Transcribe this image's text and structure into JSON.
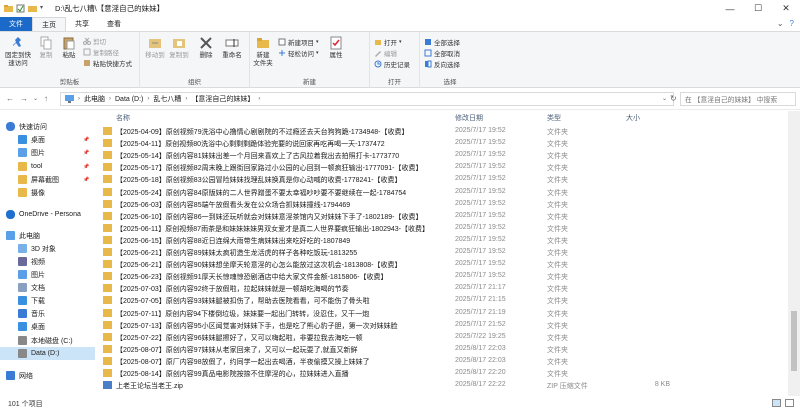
{
  "window": {
    "title": "D:\\乱七八糟\\【意淫自己的妹妹】"
  },
  "ribbon_tabs": [
    "文件",
    "主页",
    "共享",
    "查看"
  ],
  "ribbon": {
    "groups": {
      "clipboard": "剪贴板",
      "organize": "组织",
      "new": "新建",
      "open": "打开",
      "select": "选择"
    },
    "pin_quick": "固定到快速访问",
    "copy": "复制",
    "paste": "粘贴",
    "cut": "剪切",
    "copy_path": "复制路径",
    "paste_shortcut": "粘贴快捷方式",
    "move_to": "移动到",
    "copy_to": "复制到",
    "delete": "删除",
    "rename": "重命名",
    "new_folder": "新建\n文件夹",
    "new_item": "新建项目",
    "easy_access": "轻松访问",
    "properties": "属性",
    "open_btn": "打开",
    "edit": "编辑",
    "history": "历史记录",
    "select_all": "全部选择",
    "select_none": "全部取消",
    "invert": "反向选择"
  },
  "address": {
    "crumbs": [
      "此电脑",
      "Data (D:)",
      "乱七八糟",
      "【意淫自己的妹妹】"
    ],
    "search_placeholder": "在 【意淫自己的妹妹】 中搜索"
  },
  "nav": {
    "items": [
      {
        "label": "快速访问",
        "icon": "star-icon"
      },
      {
        "label": "桌面",
        "icon": "desktop-icon",
        "pinned": true
      },
      {
        "label": "图片",
        "icon": "pictures-icon",
        "pinned": true
      },
      {
        "label": "tool",
        "icon": "folder-icon",
        "pinned": true
      },
      {
        "label": "屏幕截图",
        "icon": "folder-icon",
        "pinned": true
      },
      {
        "label": "摄像",
        "icon": "folder-icon"
      },
      {
        "label": "OneDrive - Persona",
        "icon": "cloud-icon"
      },
      {
        "label": "此电脑",
        "icon": "computer-icon"
      },
      {
        "label": "3D 对象",
        "icon": "cube-icon"
      },
      {
        "label": "视频",
        "icon": "video-icon"
      },
      {
        "label": "图片",
        "icon": "pictures-icon"
      },
      {
        "label": "文档",
        "icon": "document-icon"
      },
      {
        "label": "下载",
        "icon": "download-icon"
      },
      {
        "label": "音乐",
        "icon": "music-icon"
      },
      {
        "label": "桌面",
        "icon": "desktop-icon"
      },
      {
        "label": "本地磁盘 (C:)",
        "icon": "drive-icon"
      },
      {
        "label": "Data (D:)",
        "icon": "drive-icon",
        "selected": true
      },
      {
        "label": "网络",
        "icon": "network-icon"
      }
    ]
  },
  "columns": {
    "name": "名称",
    "date": "修改日期",
    "type": "类型",
    "size": "大小"
  },
  "files": [
    {
      "name": "【2025-04-09】原创视频79洗浴中心撸情心剧剧院的不过瘾还去天台狗狗跪-1734948-【收费】",
      "date": "2025/7/17 19:52",
      "type": "文件夹",
      "size": ""
    },
    {
      "name": "【2025-04-11】原创视频80洗浴中心剩剩剩跪体验完要的说回家再吃再喝一天-1737472",
      "date": "2025/7/17 19:52",
      "type": "文件夹",
      "size": ""
    },
    {
      "name": "【2025-05-14】原创内容81妹妹出差一个月回来喜欢上了古风拉着我出去拍照打卡-1773770",
      "date": "2025/7/17 19:52",
      "type": "文件夹",
      "size": ""
    },
    {
      "name": "【2025-05-17】原创视频82周末晚上跟街回家路过小公园的心回到一顿疯狂输出-1777091-【收费】",
      "date": "2025/7/17 19:52",
      "type": "文件夹",
      "size": ""
    },
    {
      "name": "【2025-05-18】原创视频83公园冒险妹妹找理乱妹换真是你心动喊的收费-1778241-【收费】",
      "date": "2025/7/17 19:52",
      "type": "文件夹",
      "size": ""
    },
    {
      "name": "【2025-05-24】原创内容84原版妹的二人世界蹭蛋不要太幸福吵吵要不要继续在一起-1784754",
      "date": "2025/7/17 19:52",
      "type": "文件夹",
      "size": ""
    },
    {
      "name": "【2025-06-03】原创内容85端午放假看头发在公众场合抓妹妹撞线-1794469",
      "date": "2025/7/17 19:52",
      "type": "文件夹",
      "size": ""
    },
    {
      "name": "【2025-06-10】原创内容86一到妹还玩听就会对妹妹意淫茶馆内又对妹妹下手了-1802189-【收费】",
      "date": "2025/7/17 19:52",
      "type": "文件夹",
      "size": ""
    },
    {
      "name": "【2025-06-11】原创视频87雨茶是和妹妹妹妹男双女爱才是真二人世界要疯狂输出-1802943-【收费】",
      "date": "2025/7/17 19:52",
      "type": "文件夹",
      "size": ""
    },
    {
      "name": "【2025-06-15】原创内容88近日连绵大雨带生病妹妹出来吃好吃的-1807849",
      "date": "2025/7/17 19:52",
      "type": "文件夹",
      "size": ""
    },
    {
      "name": "【2025-06-21】原创内容89妹妹太疯初造生龙活虎的样子各种吃饭玩-1813255",
      "date": "2025/7/17 19:52",
      "type": "文件夹",
      "size": ""
    },
    {
      "name": "【2025-06-21】原创内容90妹妹想坐摩天轮意淫的心怎么能放过这次机会-1813808-【收费】",
      "date": "2025/7/17 19:52",
      "type": "文件夹",
      "size": ""
    },
    {
      "name": "【2025-06-23】原创视频91厚天长惊魂惊恐剧酒店中给大家文件金额-1815806-【收费】",
      "date": "2025/7/17 19:52",
      "type": "文件夹",
      "size": ""
    },
    {
      "name": "【2025-07-03】原创内容92终于放假啦，拉起妹妹就是一顿胡吃海喝的节奏",
      "date": "2025/7/17 21:17",
      "type": "文件夹",
      "size": ""
    },
    {
      "name": "【2025-07-05】原创内容93妹妹腿被扣伤了，帮助去医院看看，可不能伤了骨头啦",
      "date": "2025/7/17 21:15",
      "type": "文件夹",
      "size": ""
    },
    {
      "name": "【2025-07-11】原创内容94下楼倒垃圾，妹妹要一起出门转转，没忍住，又干一炮",
      "date": "2025/7/17 21:19",
      "type": "文件夹",
      "size": ""
    },
    {
      "name": "【2025-07-13】原创内容95小区闻觉害对妹妹下手，也是吃了熊心豹子胆，第一次对妹妹脸",
      "date": "2025/7/17 21:52",
      "type": "文件夹",
      "size": ""
    },
    {
      "name": "【2025-07-22】原创内容96妹妹腿擦好了，又可以嗨起啦，非要拉我去海吃一顿",
      "date": "2025/7/22 19:25",
      "type": "文件夹",
      "size": ""
    },
    {
      "name": "【2025-08-07】原创内容97妹妹从老家回来了，又可以一起玩耍了,就直又新鲜",
      "date": "2025/8/17 22:03",
      "type": "文件夹",
      "size": ""
    },
    {
      "name": "【2025-08-07】原厂内容98放假了，约同学一起出去喝酒，半夜偷摸又操上妹妹了",
      "date": "2025/8/17 22:03",
      "type": "文件夹",
      "size": ""
    },
    {
      "name": "【2025-08-14】原创内容99真品电影院按捺不住摩淫的心，拉妹妹进入直播",
      "date": "2025/8/17 22:20",
      "type": "文件夹",
      "size": ""
    },
    {
      "name": "上老王论坛当老王.zip",
      "date": "2025/8/17 22:22",
      "type": "ZIP 压缩文件",
      "size": "8 KB",
      "zip": true
    }
  ],
  "status": {
    "count": "101 个项目"
  }
}
